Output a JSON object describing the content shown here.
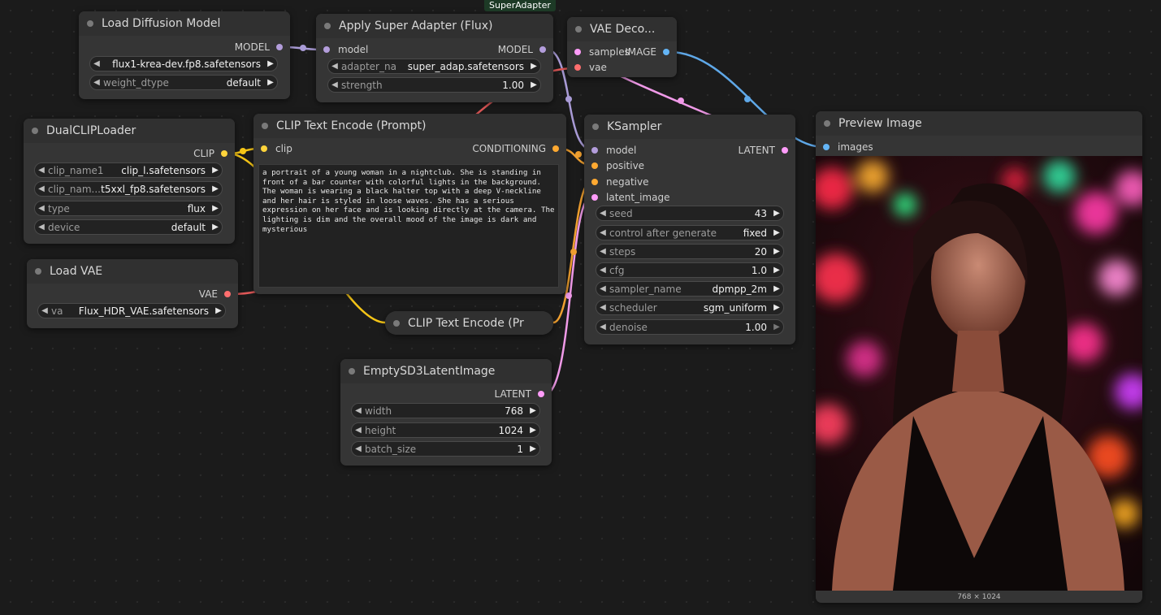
{
  "group": {
    "label": "SuperAdapter"
  },
  "nodes": {
    "load_diffusion": {
      "title": "Load Diffusion Model",
      "output": "MODEL",
      "widgets": [
        {
          "label": "",
          "value": "flux1-krea-dev.fp8.safetensors"
        },
        {
          "label": "weight_dtype",
          "value": "default"
        }
      ]
    },
    "super_adapter": {
      "title": "Apply Super Adapter (Flux)",
      "input": "model",
      "output": "MODEL",
      "widgets": [
        {
          "label": "adapter_na",
          "value": "super_adap.safetensors"
        },
        {
          "label": "strength",
          "value": "1.00"
        }
      ]
    },
    "vae_decode": {
      "title": "VAE Deco...",
      "inputs": [
        "samples",
        "vae"
      ],
      "output": "IMAGE"
    },
    "dual_clip": {
      "title": "DualCLIPLoader",
      "output": "CLIP",
      "widgets": [
        {
          "label": "clip_name1",
          "value": "clip_l.safetensors"
        },
        {
          "label": "clip_nam...",
          "value": "t5xxl_fp8.safetensors"
        },
        {
          "label": "type",
          "value": "flux"
        },
        {
          "label": "device",
          "value": "default"
        }
      ]
    },
    "clip_text_encode": {
      "title": "CLIP Text Encode (Prompt)",
      "input": "clip",
      "output": "CONDITIONING",
      "text": "a portrait of a young woman in a nightclub. She is standing in front of a bar counter with colorful lights in the background. The woman is wearing a black halter top with a deep V-neckline and her hair is styled in loose waves. She has a serious expression on her face and is looking directly at the camera. The lighting is dim and the overall mood of the image is dark and mysterious"
    },
    "load_vae": {
      "title": "Load VAE",
      "output": "VAE",
      "widgets": [
        {
          "label": "va",
          "value": "Flux_HDR_VAE.safetensors"
        }
      ]
    },
    "clip_text_encode_2": {
      "title": "CLIP Text Encode (Pr"
    },
    "ksampler": {
      "title": "KSampler",
      "inputs": [
        "model",
        "positive",
        "negative",
        "latent_image"
      ],
      "output": "LATENT",
      "widgets": [
        {
          "label": "seed",
          "value": "43"
        },
        {
          "label": "control after generate",
          "value": "fixed"
        },
        {
          "label": "steps",
          "value": "20"
        },
        {
          "label": "cfg",
          "value": "1.0"
        },
        {
          "label": "sampler_name",
          "value": "dpmpp_2m"
        },
        {
          "label": "scheduler",
          "value": "sgm_uniform"
        },
        {
          "label": "denoise",
          "value": "1.00"
        }
      ]
    },
    "empty_latent": {
      "title": "EmptySD3LatentImage",
      "output": "LATENT",
      "widgets": [
        {
          "label": "width",
          "value": "768"
        },
        {
          "label": "height",
          "value": "1024"
        },
        {
          "label": "batch_size",
          "value": "1"
        }
      ]
    },
    "preview": {
      "title": "Preview Image",
      "input": "images",
      "caption": "768 × 1024"
    }
  },
  "colors": {
    "model": "#b39ddb",
    "clip": "#ffd43b",
    "conditioning": "#ffa931",
    "vae": "#ff6e6e",
    "latent": "#ff9cf9",
    "image": "#64b5f6"
  }
}
